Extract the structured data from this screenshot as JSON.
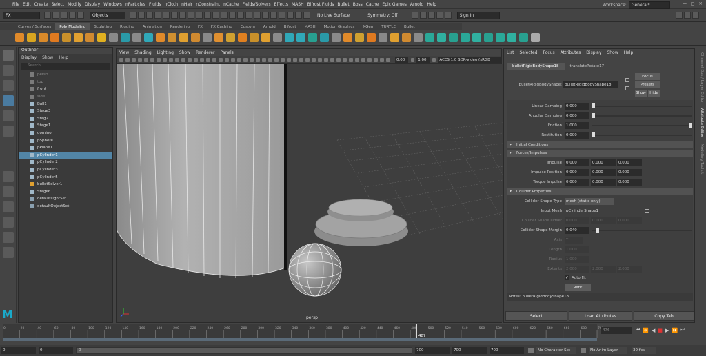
{
  "menubar": {
    "items": [
      "File",
      "Edit",
      "Create",
      "Select",
      "Modify",
      "Display",
      "Windows",
      "nParticles",
      "Fluids",
      "nCloth",
      "nHair",
      "nConstraint",
      "nCache",
      "Fields/Solvers",
      "Effects",
      "MASH",
      "Bifrost Fluids",
      "Bullet",
      "Boss",
      "Cache",
      "Epic Games",
      "Arnold",
      "Help"
    ],
    "workspace_label": "Workspace:",
    "workspace_value": "General*"
  },
  "statusline": {
    "menuset": "FX",
    "select_mode": "Objects",
    "live_surface": "No Live Surface",
    "symmetry": "Symmetry: Off",
    "sign_in": "Sign In"
  },
  "shelf": {
    "tabs": [
      "Curves / Surfaces",
      "Poly Modeling",
      "Sculpting",
      "Rigging",
      "Animation",
      "Rendering",
      "FX",
      "FX Caching",
      "Custom",
      "Arnold",
      "Bifrost",
      "MASH",
      "Motion Graphics",
      "XGen",
      "TURTLE",
      "Bullet"
    ],
    "active_tab": "Poly Modeling"
  },
  "outliner": {
    "title": "Outliner",
    "menu": [
      "Display",
      "Show",
      "Help"
    ],
    "search_placeholder": "Search...",
    "items": [
      {
        "label": "persp",
        "dim": true,
        "color": "#7a7a7a",
        "sel": false
      },
      {
        "label": "top",
        "dim": true,
        "color": "#7a7a7a",
        "sel": false
      },
      {
        "label": "front",
        "dim": false,
        "color": "#7a7a7a",
        "sel": false
      },
      {
        "label": "side",
        "dim": true,
        "color": "#7a7a7a",
        "sel": false
      },
      {
        "label": "Ball1",
        "dim": false,
        "color": "#a0b8c8",
        "sel": false
      },
      {
        "label": "Stage3",
        "dim": false,
        "color": "#a0b8c8",
        "sel": false
      },
      {
        "label": "Stag2",
        "dim": false,
        "color": "#a0b8c8",
        "sel": false
      },
      {
        "label": "Stage1",
        "dim": false,
        "color": "#a0b8c8",
        "sel": false
      },
      {
        "label": "domino",
        "dim": false,
        "color": "#a0b8c8",
        "sel": false
      },
      {
        "label": "pSphere1",
        "dim": false,
        "color": "#a0b8c8",
        "sel": false
      },
      {
        "label": "pPlane1",
        "dim": false,
        "color": "#a0b8c8",
        "sel": false
      },
      {
        "label": "pCylinder1",
        "dim": false,
        "color": "#a0b8c8",
        "sel": true
      },
      {
        "label": "pCylinder2",
        "dim": false,
        "color": "#a0b8c8",
        "sel": false
      },
      {
        "label": "pCylinder3",
        "dim": false,
        "color": "#a0b8c8",
        "sel": false
      },
      {
        "label": "pCylinder5",
        "dim": false,
        "color": "#a0b8c8",
        "sel": false
      },
      {
        "label": "bulletSolver1",
        "dim": false,
        "color": "#e0a030",
        "sel": false
      },
      {
        "label": "Stage6",
        "dim": false,
        "color": "#a0b8c8",
        "sel": false
      },
      {
        "label": "defaultLightSet",
        "dim": false,
        "color": "#8aa0b0",
        "sel": false
      },
      {
        "label": "defaultObjectSet",
        "dim": false,
        "color": "#8aa0b0",
        "sel": false
      }
    ]
  },
  "viewport": {
    "menu": [
      "View",
      "Shading",
      "Lighting",
      "Show",
      "Renderer",
      "Panels"
    ],
    "exposure": "0.00",
    "gamma": "1.00",
    "color_space": "ACES 1.0 SDR-video (sRGB",
    "camera_label": "persp"
  },
  "attribute_editor": {
    "menu": [
      "List",
      "Selected",
      "Focus",
      "Attributes",
      "Display",
      "Show",
      "Help"
    ],
    "tabs": [
      "bulletRigidBodyShape18",
      "translateRotate17"
    ],
    "node_label": "bulletRigidBodyShape:",
    "node_value": "bulletRigidBodyShape18",
    "focus": "Focus",
    "presets": "Presets",
    "show": "Show",
    "hide": "Hide",
    "linear_damping_label": "Linear Damping",
    "linear_damping": "0.000",
    "angular_damping_label": "Angular Damping",
    "angular_damping": "0.000",
    "friction_label": "Friction",
    "friction": "1.000",
    "restitution_label": "Restitution",
    "restitution": "0.000",
    "sec_initial": "Initial Conditions",
    "sec_forces": "Forces/Impulses",
    "impulse_label": "Impulse",
    "impulse": [
      "0.000",
      "0.000",
      "0.000"
    ],
    "impulse_pos_label": "Impulse Position",
    "impulse_pos": [
      "0.000",
      "0.000",
      "0.000"
    ],
    "torque_label": "Torque Impulse",
    "torque": [
      "0.000",
      "0.000",
      "0.000"
    ],
    "sec_collider": "Collider Properties",
    "shape_type_label": "Collider Shape Type",
    "shape_type": "mesh (static only)",
    "input_mesh_label": "Input Mesh",
    "input_mesh": "pCylinderShape1",
    "offset_label": "Collider Shape Offset",
    "offset": [
      "0.000",
      "0.000",
      "0.000"
    ],
    "margin_label": "Collider Shape Margin",
    "margin": "0.040",
    "axis_label": "Axis",
    "axis": "Y",
    "length_label": "Length",
    "length": "1.000",
    "radius_label": "Radius",
    "radius": "1.000",
    "extents_label": "Extents",
    "extents": [
      "2.000",
      "2.000",
      "2.000"
    ],
    "autofit": "Auto Fit",
    "refit": "Refit",
    "notes": "Notes:  bulletRigidBodyShape18",
    "select_btn": "Select",
    "load_btn": "Load Attributes",
    "copy_btn": "Copy Tab"
  },
  "side_tabs": [
    "Channel Box / Layer Editor",
    "Attribute Editor",
    "Modeling Toolkit"
  ],
  "timeline": {
    "ticks": [
      "0",
      "20",
      "40",
      "60",
      "80",
      "100",
      "120",
      "140",
      "160",
      "180",
      "200",
      "220",
      "240",
      "260",
      "280",
      "300",
      "320",
      "340",
      "360",
      "380",
      "400",
      "420",
      "440",
      "460",
      "480",
      "500",
      "520",
      "540",
      "560",
      "580",
      "600",
      "620",
      "640",
      "660",
      "680",
      "700"
    ],
    "current_frame": "487",
    "current_fraction": 0.696,
    "frame_field": "476"
  },
  "range": {
    "start": "0",
    "start_anim": "0",
    "inner_start": "0",
    "inner_end": "700",
    "end": "700",
    "end_anim": "700",
    "character_set": "No Character Set",
    "anim_layer": "No Anim Layer",
    "fps": "30 fps"
  }
}
